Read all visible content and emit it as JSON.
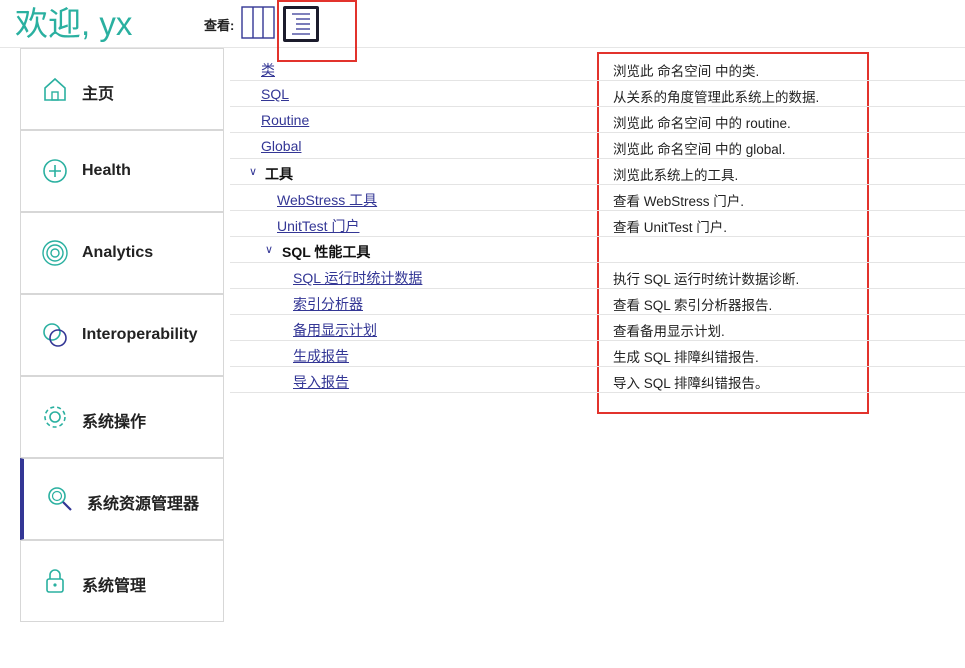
{
  "header": {
    "welcome": "欢迎, yx",
    "view_label": "查看:"
  },
  "sidebar": {
    "items": [
      {
        "label": "主页",
        "icon": "home-icon"
      },
      {
        "label": "Health",
        "icon": "health-icon"
      },
      {
        "label": "Analytics",
        "icon": "analytics-icon"
      },
      {
        "label": "Interoperability",
        "icon": "interoperability-icon"
      },
      {
        "label": "系统操作",
        "icon": "gear-icon"
      },
      {
        "label": "系统资源管理器",
        "icon": "search-icon",
        "active": true
      },
      {
        "label": "系统管理",
        "icon": "lock-icon"
      }
    ]
  },
  "table": {
    "rows": [
      {
        "name": "类",
        "desc": "浏览此 命名空间 中的类."
      },
      {
        "name": "SQL",
        "desc": "从关系的角度管理此系统上的数据."
      },
      {
        "name": "Routine",
        "desc": "浏览此 命名空间 中的 routine."
      },
      {
        "name": "Global",
        "desc": "浏览此 命名空间 中的 global."
      },
      {
        "name": "工具",
        "desc": "浏览此系统上的工具."
      },
      {
        "name": "WebStress 工具",
        "desc": "查看 WebStress 门户."
      },
      {
        "name": "UnitTest 门户",
        "desc": "查看 UnitTest 门户."
      },
      {
        "name": "SQL 性能工具",
        "desc": ""
      },
      {
        "name": "SQL 运行时统计数据",
        "desc": "执行 SQL 运行时统计数据诊断."
      },
      {
        "name": "索引分析器",
        "desc": "查看 SQL 索引分析器报告."
      },
      {
        "name": "备用显示计划",
        "desc": "查看备用显示计划."
      },
      {
        "name": "生成报告",
        "desc": "生成 SQL 排障纠错报告."
      },
      {
        "name": "导入报告",
        "desc": "导入 SQL 排障纠错报告。"
      }
    ]
  },
  "colors": {
    "accent": "#333695",
    "welcome": "#2ab0a0",
    "icon": "#2ab0a0",
    "highlight": "#e2332c"
  }
}
